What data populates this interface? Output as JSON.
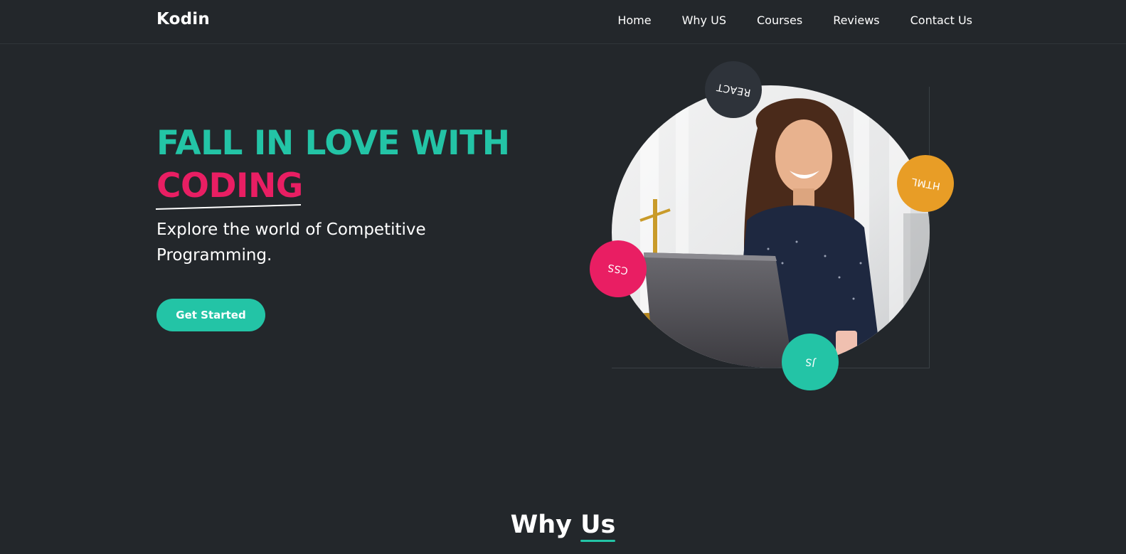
{
  "brand": {
    "logo": "Kodin"
  },
  "nav": {
    "items": [
      {
        "label": "Home"
      },
      {
        "label": "Why US"
      },
      {
        "label": "Courses"
      },
      {
        "label": "Reviews"
      },
      {
        "label": "Contact Us"
      }
    ]
  },
  "hero": {
    "title_line1": "FALL IN LOVE WITH",
    "title_line2": "CODING",
    "subtitle": "Explore the world of Competitive Programming.",
    "cta_label": "Get Started",
    "badges": {
      "react": "REACT",
      "html": "HTML",
      "css": "CSS",
      "js": "JS"
    }
  },
  "why": {
    "title_part1": "Why ",
    "title_part2": "Us"
  },
  "colors": {
    "background": "#23272b",
    "primary": "#23c4a6",
    "accent": "#e91e63",
    "orange": "#e89d26",
    "dark_badge": "#2e333a"
  }
}
